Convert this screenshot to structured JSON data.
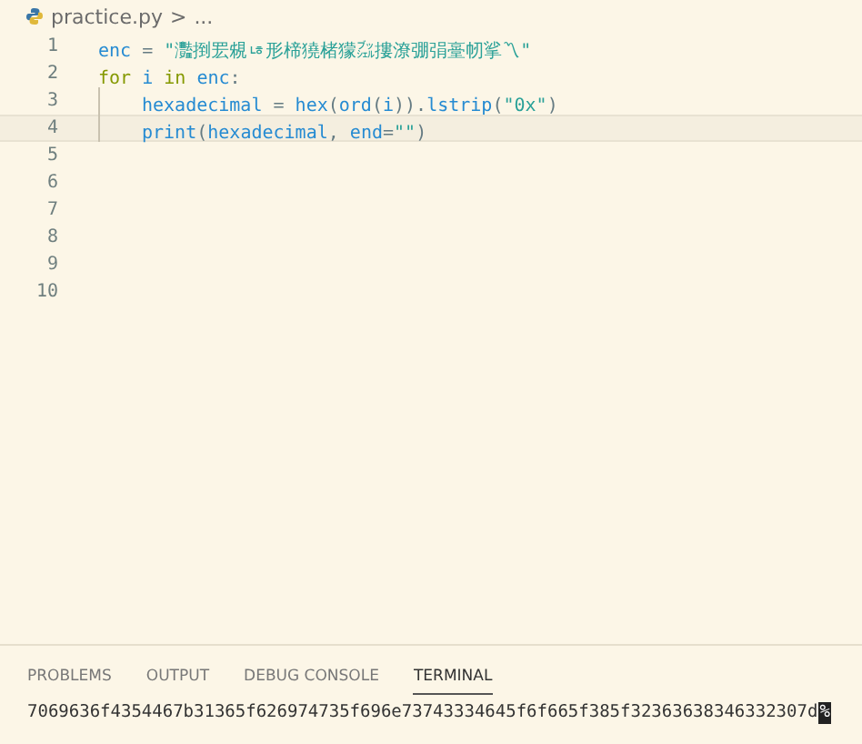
{
  "breadcrumb": {
    "file": "practice.py",
    "separator": ">",
    "rest": "..."
  },
  "editor": {
    "lines": [
      {
        "number": "1",
        "current": false,
        "indent": false,
        "tokens": [
          {
            "kind": "variable",
            "text": "enc"
          },
          {
            "kind": "punct",
            "text": " = "
          },
          {
            "kind": "string",
            "text": "\"灩捯䍔䙻ㄶ形楴獟楮獴㌴摟潦弸弲㙶㠴挲〽\""
          }
        ]
      },
      {
        "number": "2",
        "current": false,
        "indent": false,
        "tokens": [
          {
            "kind": "keyword",
            "text": "for "
          },
          {
            "kind": "variable",
            "text": "i "
          },
          {
            "kind": "keyword",
            "text": "in "
          },
          {
            "kind": "variable",
            "text": "enc"
          },
          {
            "kind": "punct",
            "text": ":"
          }
        ]
      },
      {
        "number": "3",
        "current": false,
        "indent": true,
        "tokens": [
          {
            "kind": "variable",
            "text": "hexadecimal"
          },
          {
            "kind": "punct",
            "text": " = "
          },
          {
            "kind": "function",
            "text": "hex"
          },
          {
            "kind": "punct",
            "text": "("
          },
          {
            "kind": "function",
            "text": "ord"
          },
          {
            "kind": "punct",
            "text": "("
          },
          {
            "kind": "variable",
            "text": "i"
          },
          {
            "kind": "punct",
            "text": "))."
          },
          {
            "kind": "function",
            "text": "lstrip"
          },
          {
            "kind": "punct",
            "text": "("
          },
          {
            "kind": "string",
            "text": "\"0x\""
          },
          {
            "kind": "punct",
            "text": ")"
          }
        ]
      },
      {
        "number": "4",
        "current": true,
        "indent": true,
        "tokens": [
          {
            "kind": "function",
            "text": "print"
          },
          {
            "kind": "punct",
            "text": "("
          },
          {
            "kind": "variable",
            "text": "hexadecimal"
          },
          {
            "kind": "punct",
            "text": ", "
          },
          {
            "kind": "variable",
            "text": "end"
          },
          {
            "kind": "punct",
            "text": "="
          },
          {
            "kind": "string",
            "text": "\"\""
          },
          {
            "kind": "punct",
            "text": ")"
          }
        ]
      },
      {
        "number": "5",
        "current": false,
        "indent": false
      },
      {
        "number": "6",
        "current": false,
        "indent": false
      },
      {
        "number": "7",
        "current": false,
        "indent": false
      },
      {
        "number": "8",
        "current": false,
        "indent": false
      },
      {
        "number": "9",
        "current": false,
        "indent": false
      },
      {
        "number": "10",
        "current": false,
        "indent": false
      }
    ]
  },
  "panel": {
    "tabs": [
      {
        "label": "PROBLEMS",
        "selected": false
      },
      {
        "label": "OUTPUT",
        "selected": false
      },
      {
        "label": "DEBUG CONSOLE",
        "selected": false
      },
      {
        "label": "TERMINAL",
        "selected": true
      }
    ],
    "terminal": {
      "output": "7069636f4354467b31365f626974735f696e73743334645f6f665f385f32363638346332307d",
      "cursor": "%"
    }
  }
}
